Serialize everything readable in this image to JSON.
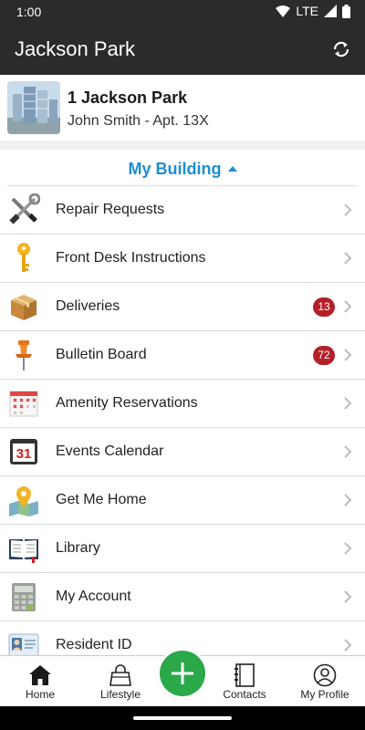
{
  "status_bar": {
    "time": "1:00",
    "network": "LTE"
  },
  "app_bar": {
    "title": "Jackson Park"
  },
  "building": {
    "name": "1 Jackson Park",
    "resident": "John Smith - Apt. 13X"
  },
  "section": {
    "title": "My Building"
  },
  "menu": [
    {
      "label": "Repair Requests",
      "icon": "tools-icon",
      "badge": ""
    },
    {
      "label": "Front Desk Instructions",
      "icon": "key-icon",
      "badge": ""
    },
    {
      "label": "Deliveries",
      "icon": "package-icon",
      "badge": "13"
    },
    {
      "label": "Bulletin Board",
      "icon": "pushpin-icon",
      "badge": "72"
    },
    {
      "label": "Amenity Reservations",
      "icon": "reservation-calendar-icon",
      "badge": ""
    },
    {
      "label": "Events Calendar",
      "icon": "calendar-31-icon",
      "badge": ""
    },
    {
      "label": "Get Me Home",
      "icon": "map-pin-icon",
      "badge": ""
    },
    {
      "label": "Library",
      "icon": "book-icon",
      "badge": ""
    },
    {
      "label": "My Account",
      "icon": "calculator-icon",
      "badge": ""
    },
    {
      "label": "Resident ID",
      "icon": "id-card-icon",
      "badge": ""
    }
  ],
  "bottom_nav": {
    "home": "Home",
    "lifestyle": "Lifestyle",
    "contacts": "Contacts",
    "profile": "My Profile"
  },
  "colors": {
    "app_bar": "#2b2b2b",
    "accent": "#1b8fd1",
    "badge": "#b3202a",
    "fab": "#2ba84a"
  }
}
